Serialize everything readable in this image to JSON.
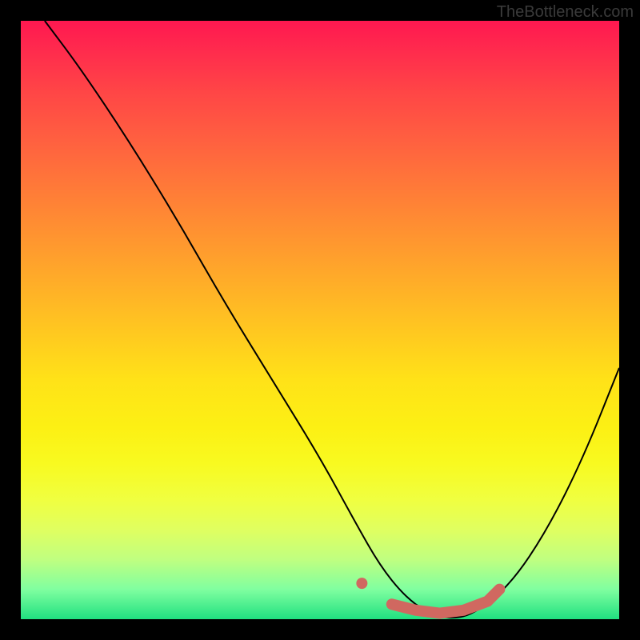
{
  "watermark": "TheBottleneck.com",
  "chart_data": {
    "type": "line",
    "title": "",
    "xlabel": "",
    "ylabel": "",
    "xlim": [
      0,
      100
    ],
    "ylim": [
      0,
      100
    ],
    "series": [
      {
        "name": "bottleneck-curve",
        "x": [
          4,
          10,
          18,
          26,
          34,
          42,
          50,
          56,
          60,
          64,
          68,
          72,
          76,
          82,
          88,
          94,
          100
        ],
        "y": [
          100,
          92,
          80,
          67,
          53,
          40,
          27,
          16,
          9,
          4,
          1,
          0,
          1,
          6,
          15,
          27,
          42
        ]
      }
    ],
    "annotations": [
      {
        "name": "marker-left",
        "type": "dot",
        "x": 57,
        "y": 6,
        "color": "#d06860"
      },
      {
        "name": "marker-valley",
        "type": "thick-segment",
        "x": [
          62,
          66,
          70,
          74,
          78,
          80
        ],
        "y": [
          2.5,
          1.5,
          1,
          1.5,
          3,
          5
        ],
        "color": "#d06860"
      }
    ],
    "colors": {
      "curve": "#000000",
      "marker": "#d06860",
      "gradient_top": "#ff1850",
      "gradient_bottom": "#20e080"
    }
  }
}
